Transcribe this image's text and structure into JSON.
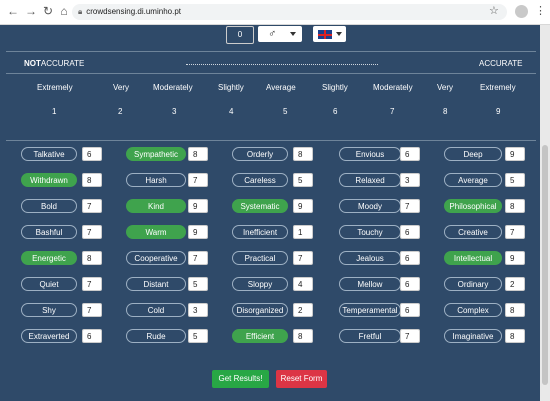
{
  "browser": {
    "url": "crowdsensing.di.uminho.pt"
  },
  "top": {
    "count_value": "0",
    "gender_icon": "male-symbol",
    "language_flag": "uk-flag"
  },
  "scale": {
    "left": "NOT ACCURATE",
    "left_bold": "NOT",
    "left_rest": "ACCURATE",
    "right": "ACCURATE"
  },
  "degrees": [
    "Extremely",
    "Very",
    "Moderately",
    "Slightly",
    "Average",
    "Slightly",
    "Moderately",
    "Very",
    "Extremely"
  ],
  "numbers": [
    "1",
    "2",
    "3",
    "4",
    "5",
    "6",
    "7",
    "8",
    "9"
  ],
  "traits": [
    [
      {
        "label": "Talkative",
        "value": "6",
        "selected": false
      },
      {
        "label": "Sympathetic",
        "value": "8",
        "selected": true
      },
      {
        "label": "Orderly",
        "value": "8",
        "selected": false
      },
      {
        "label": "Envious",
        "value": "6",
        "selected": false
      },
      {
        "label": "Deep",
        "value": "9",
        "selected": false
      }
    ],
    [
      {
        "label": "Withdrawn",
        "value": "8",
        "selected": true
      },
      {
        "label": "Harsh",
        "value": "7",
        "selected": false
      },
      {
        "label": "Careless",
        "value": "5",
        "selected": false
      },
      {
        "label": "Relaxed",
        "value": "3",
        "selected": false
      },
      {
        "label": "Average",
        "value": "5",
        "selected": false
      }
    ],
    [
      {
        "label": "Bold",
        "value": "7",
        "selected": false
      },
      {
        "label": "Kind",
        "value": "9",
        "selected": true
      },
      {
        "label": "Systematic",
        "value": "9",
        "selected": true
      },
      {
        "label": "Moody",
        "value": "7",
        "selected": false
      },
      {
        "label": "Philosophical",
        "value": "8",
        "selected": true
      }
    ],
    [
      {
        "label": "Bashful",
        "value": "7",
        "selected": false
      },
      {
        "label": "Warm",
        "value": "9",
        "selected": true
      },
      {
        "label": "Inefficient",
        "value": "1",
        "selected": false
      },
      {
        "label": "Touchy",
        "value": "6",
        "selected": false
      },
      {
        "label": "Creative",
        "value": "7",
        "selected": false
      }
    ],
    [
      {
        "label": "Energetic",
        "value": "8",
        "selected": true
      },
      {
        "label": "Cooperative",
        "value": "7",
        "selected": false
      },
      {
        "label": "Practical",
        "value": "7",
        "selected": false
      },
      {
        "label": "Jealous",
        "value": "6",
        "selected": false
      },
      {
        "label": "Intellectual",
        "value": "9",
        "selected": true
      }
    ],
    [
      {
        "label": "Quiet",
        "value": "7",
        "selected": false
      },
      {
        "label": "Distant",
        "value": "5",
        "selected": false
      },
      {
        "label": "Sloppy",
        "value": "4",
        "selected": false
      },
      {
        "label": "Mellow",
        "value": "6",
        "selected": false
      },
      {
        "label": "Ordinary",
        "value": "2",
        "selected": false
      }
    ],
    [
      {
        "label": "Shy",
        "value": "7",
        "selected": false
      },
      {
        "label": "Cold",
        "value": "3",
        "selected": false
      },
      {
        "label": "Disorganized",
        "value": "2",
        "selected": false
      },
      {
        "label": "Temperamental",
        "value": "6",
        "selected": false
      },
      {
        "label": "Complex",
        "value": "8",
        "selected": false
      }
    ],
    [
      {
        "label": "Extraverted",
        "value": "6",
        "selected": false
      },
      {
        "label": "Rude",
        "value": "5",
        "selected": false
      },
      {
        "label": "Efficient",
        "value": "8",
        "selected": true
      },
      {
        "label": "Fretful",
        "value": "7",
        "selected": false
      },
      {
        "label": "Imaginative",
        "value": "8",
        "selected": false
      }
    ]
  ],
  "actions": {
    "submit": "Get Results!",
    "reset": "Reset Form"
  },
  "colors": {
    "background": "#2f4a69",
    "selected": "#3fa34d",
    "submit": "#28a745",
    "reset": "#dc3545"
  }
}
